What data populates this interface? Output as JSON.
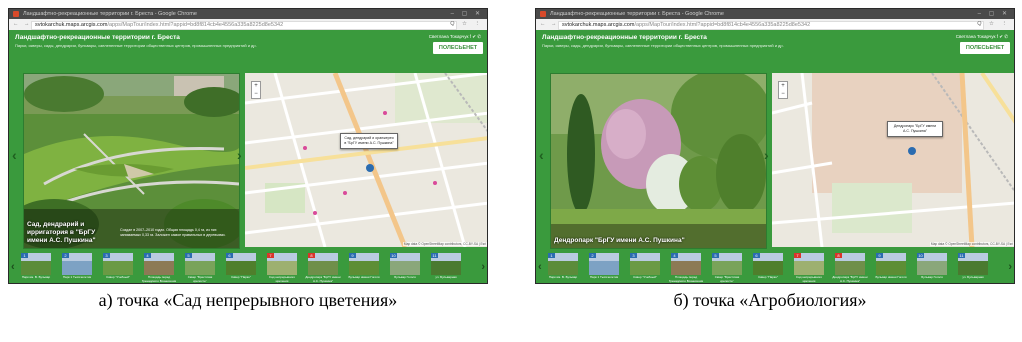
{
  "browser": {
    "window_title": "Ландшафтно-рекреационные территории г. Бреста - Google Chrome",
    "nav_glyphs": "← → C",
    "url_host": "svtokarchuk.maps.arcgis.com",
    "url_path": "/apps/MapTour/index.html?appid=bd8f814cb4e4556a335a8225d8e5342",
    "tools": "Q ☆ ⋮",
    "window_buttons": "– ▢ ✕"
  },
  "app": {
    "title": "Ландшафтно-рекреационные территории г. Бреста",
    "subtitle": "Парки, скверы, сады, дендрарии, бульвары, озелененные территории общественных центров, промышленных предприятий и др.",
    "share": "Светлана Токарчук f ✔ ✆",
    "logo_text": "ПОЛЕСЬЕНЕТ",
    "attribution": "Map data © OpenStreetMap contributors, CC-BY-SA | Esri"
  },
  "screens": [
    {
      "caption": "Сад, дендрарий и ирригатория в \"БрГУ имени А.С. Пушкина\"",
      "description": "Создан в 2007–2010 годах. Общая площадь 0,4 га, из них занимаемых 0,33 га. Заложен самое правильных в деревьями.",
      "popup": "Сад, дендрарий и оранжерея в \"БрГУ имени А.С. Пушкина\""
    },
    {
      "caption": "Дендропарк \"БрГУ имени А.С. Пушкина\"",
      "description": "",
      "popup": "Дендропарк \"БрГУ имени А.С. Пушкина\""
    }
  ],
  "thumbnails": [
    {
      "num": "1",
      "label": "Парк им. В. Бульвар",
      "color": "#2b6cb0"
    },
    {
      "num": "2",
      "label": "Парк 1 Тысячелетия",
      "color": "#2b6cb0"
    },
    {
      "num": "3",
      "label": "Сквер \"Учебный\"",
      "color": "#2b6cb0"
    },
    {
      "num": "4",
      "label": "Площадь перед Гренадского Вознесения",
      "color": "#2b6cb0"
    },
    {
      "num": "5",
      "label": "Сквер \"Брестская крепость\"",
      "color": "#2b6cb0"
    },
    {
      "num": "6",
      "label": "Сквер \"Парко\"",
      "color": "#2b6cb0"
    },
    {
      "num": "7",
      "label": "Сад непрерывного цветения",
      "color": "#d9342b"
    },
    {
      "num": "8",
      "label": "Дендропарк \"БрГУ имени А.С. Пушкина\"",
      "color": "#d9342b"
    },
    {
      "num": "9",
      "label": "Бульвар имени Гоголя",
      "color": "#2b6cb0"
    },
    {
      "num": "10",
      "label": "Бульвар Гоголя",
      "color": "#2b6cb0"
    },
    {
      "num": "11",
      "label": "ул. Бульварная",
      "color": "#2b6cb0"
    }
  ],
  "labels": {
    "a": "а) точка «Сад непрерывного цветения»",
    "b": "б) точка «Агробиология»"
  }
}
